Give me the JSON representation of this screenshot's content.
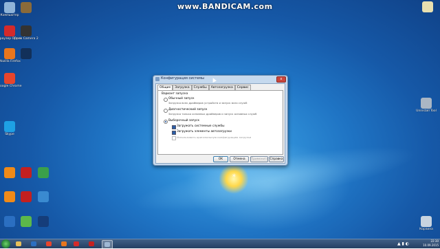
{
  "watermark": "www.BANDICAM.com",
  "desktop_icons_left": [
    {
      "label": "Компьютер",
      "icon": "computer-icon",
      "color": "#8fb4d8"
    },
    {
      "label": "Браузер Opera",
      "icon": "opera-icon",
      "color": "#d42a2a"
    },
    {
      "label": "Mozilla Firefox",
      "icon": "firefox-icon",
      "color": "#e8761e"
    },
    {
      "label": "Google Chrome",
      "icon": "chrome-icon",
      "color": "#e8452c"
    },
    {
      "label": "Skype",
      "icon": "skype-icon",
      "color": "#1ea0e4"
    }
  ],
  "desktop_icons_col2": [
    {
      "label": "",
      "icon": "image-icon",
      "color": "#8a6a3a"
    },
    {
      "label": "Open Camera 2",
      "icon": "camera-icon",
      "color": "#333333"
    },
    {
      "label": "",
      "icon": "photoshop-icon",
      "color": "#12305a"
    }
  ],
  "desktop_icons_bottom": [
    {
      "label": "",
      "icon": "app-orange-icon",
      "color": "#f08a18"
    },
    {
      "label": "",
      "icon": "app-red-icon",
      "color": "#c32020"
    },
    {
      "label": "",
      "icon": "app-globe-icon",
      "color": "#3aa04a"
    },
    {
      "label": "",
      "icon": "app-vlc-icon",
      "color": "#f08a18"
    },
    {
      "label": "",
      "icon": "app-winamp-icon",
      "color": "#c32020"
    },
    {
      "label": "",
      "icon": "app-network-icon",
      "color": "#3a8ad0"
    },
    {
      "label": "",
      "icon": "app-blue-icon",
      "color": "#2b6fc1"
    },
    {
      "label": "",
      "icon": "app-green-icon",
      "color": "#5cb84a"
    },
    {
      "label": "",
      "icon": "app-dark-icon",
      "color": "#153d7a"
    }
  ],
  "desktop_icons_right": [
    {
      "label": "Uninstall Tool",
      "icon": "uninstall-tool-icon",
      "color": "#aab6c4"
    },
    {
      "label": "Корзина",
      "icon": "recycle-bin-icon",
      "color": "#c8d4e0"
    }
  ],
  "window": {
    "title": "Конфигурация системы",
    "close_label": "x",
    "tabs": [
      {
        "label": "Общие",
        "active": true
      },
      {
        "label": "Загрузка",
        "active": false
      },
      {
        "label": "Службы",
        "active": false
      },
      {
        "label": "Автозагрузка",
        "active": false
      },
      {
        "label": "Сервис",
        "active": false
      }
    ],
    "group_label": "Вариант запуска",
    "options": [
      {
        "label": "Обычный запуск",
        "desc": "Загрузка всех драйверов устройств и запуск всех служб",
        "selected": false
      },
      {
        "label": "Диагностический запуск",
        "desc": "Загрузка только основных драйверов и запуск основных служб",
        "selected": false
      },
      {
        "label": "Выборочный запуск",
        "desc": "",
        "selected": true
      }
    ],
    "checkboxes": [
      {
        "label": "Загружать системные службы",
        "checked": true,
        "disabled": false
      },
      {
        "label": "Загружать элементы автозагрузки",
        "checked": true,
        "disabled": false
      },
      {
        "label": "Использовать оригинальную конфигурацию загрузки",
        "checked": false,
        "disabled": true
      }
    ],
    "buttons": {
      "ok": "OK",
      "cancel": "Отмена",
      "apply": "Применить",
      "help": "Справка"
    }
  },
  "taskbar": {
    "items": [
      {
        "icon": "explorer-icon",
        "color": "#e8c05a"
      },
      {
        "icon": "media-player-icon",
        "color": "#2b6fc1"
      },
      {
        "icon": "chrome-icon",
        "color": "#e8452c"
      },
      {
        "icon": "firefox-icon",
        "color": "#e8761e"
      },
      {
        "icon": "opera-icon",
        "color": "#d42a2a"
      },
      {
        "icon": "bandicam-icon",
        "color": "#c32020"
      },
      {
        "icon": "msconfig-icon",
        "color": "#9fb8d4"
      }
    ],
    "time": "22:30",
    "date": "10.09.2015"
  },
  "colors": {
    "desktop_blue": "#1f74c4",
    "window_frame": "#c5d9ee"
  }
}
